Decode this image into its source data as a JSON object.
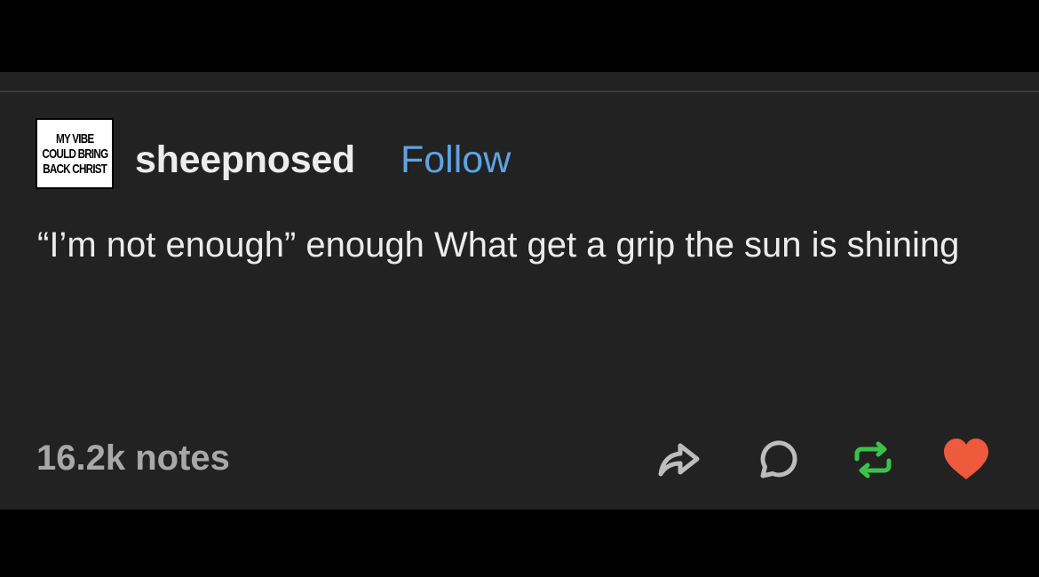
{
  "post": {
    "avatar_lines": [
      "MY VIBE",
      "COULD BRING",
      "BACK CHRIST"
    ],
    "username": "sheepnosed",
    "follow_label": "Follow",
    "body": "“I’m not enough” enough What get a grip the sun is shining",
    "notes": "16.2k notes"
  },
  "actions": {
    "share_icon": "share-arrow-icon",
    "reply_icon": "speech-bubble-icon",
    "reblog_icon": "reblog-icon",
    "like_icon": "heart-icon"
  },
  "colors": {
    "background": "#222223",
    "text": "#ececec",
    "follow": "#5fa3e3",
    "notes": "#a8a8a8",
    "reblog": "#3ac34a",
    "like": "#ee5a3c"
  }
}
